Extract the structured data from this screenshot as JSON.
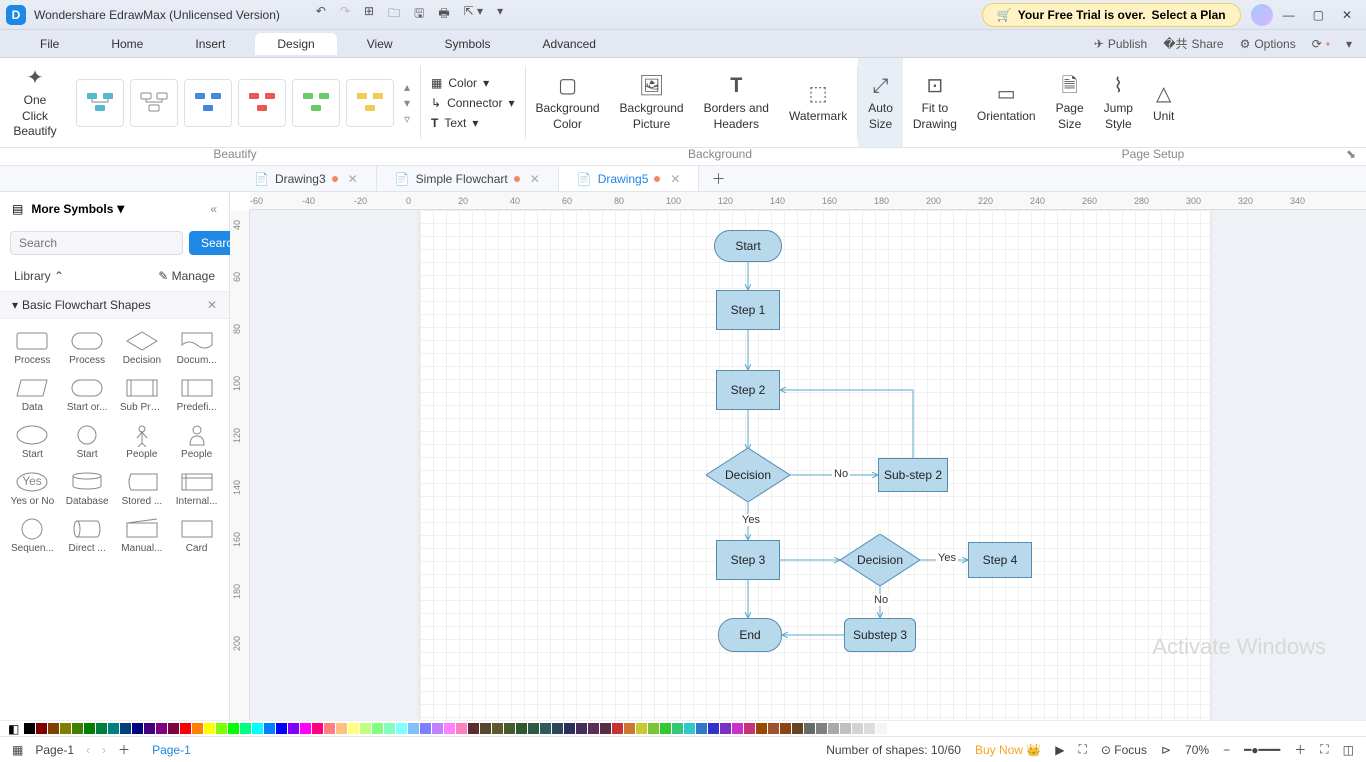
{
  "app": {
    "title": "Wondershare EdrawMax (Unlicensed Version)",
    "trial": "Your Free Trial is over.",
    "trial_cta": "Select a Plan"
  },
  "menu": {
    "items": [
      "File",
      "Home",
      "Insert",
      "Design",
      "View",
      "Symbols",
      "Advanced"
    ],
    "active": 3,
    "right": {
      "publish": "Publish",
      "share": "Share",
      "options": "Options"
    }
  },
  "ribbon": {
    "beautify": {
      "btn": "One Click\nBeautify",
      "label": "Beautify"
    },
    "midcol": {
      "color": "Color",
      "connector": "Connector",
      "text": "Text"
    },
    "bg": {
      "bgcolor": "Background\nColor",
      "bgpic": "Background\nPicture",
      "borders": "Borders and\nHeaders",
      "watermark": "Watermark",
      "label": "Background"
    },
    "ps": {
      "autosize": "Auto\nSize",
      "fit": "Fit to\nDrawing",
      "orient": "Orientation",
      "pagesize": "Page\nSize",
      "jump": "Jump\nStyle",
      "unit": "Unit",
      "label": "Page Setup"
    }
  },
  "tabs": [
    {
      "name": "Drawing3",
      "dirty": true
    },
    {
      "name": "Simple Flowchart",
      "dirty": true
    },
    {
      "name": "Drawing5",
      "dirty": true
    }
  ],
  "tabs_active": 2,
  "sidebar": {
    "more": "More Symbols",
    "search_ph": "Search",
    "search_btn": "Search",
    "library": "Library",
    "manage": "Manage",
    "panel": "Basic Flowchart Shapes",
    "shapes": [
      "Process",
      "Process",
      "Decision",
      "Docum...",
      "Data",
      "Start or...",
      "Sub Pro...",
      "Predefi...",
      "Start",
      "Start",
      "People",
      "People",
      "Yes or No",
      "Database",
      "Stored ...",
      "Internal...",
      "Sequen...",
      "Direct ...",
      "Manual...",
      "Card"
    ]
  },
  "flow": {
    "start": "Start",
    "step1": "Step 1",
    "step2": "Step 2",
    "decision1": "Decision",
    "substep2": "Sub-step 2",
    "step3": "Step 3",
    "decision2": "Decision",
    "step4": "Step 4",
    "substep3": "Substep 3",
    "end": "End",
    "yes": "Yes",
    "no": "No"
  },
  "ruler_h": [
    -60,
    -40,
    -20,
    0,
    20,
    40,
    60,
    80,
    100,
    120,
    140,
    160,
    180,
    200,
    220,
    240,
    260,
    280,
    300,
    320,
    340
  ],
  "ruler_v": [
    40,
    60,
    80,
    100,
    120,
    140,
    160,
    180,
    200
  ],
  "colors": [
    "#000000",
    "#7f0000",
    "#804000",
    "#808000",
    "#408000",
    "#008000",
    "#008040",
    "#008080",
    "#004080",
    "#000080",
    "#400080",
    "#800080",
    "#800040",
    "#ff0000",
    "#ff8000",
    "#ffff00",
    "#80ff00",
    "#00ff00",
    "#00ff80",
    "#00ffff",
    "#0080ff",
    "#0000ff",
    "#8000ff",
    "#ff00ff",
    "#ff0080",
    "#ff8080",
    "#ffc080",
    "#ffff80",
    "#c0ff80",
    "#80ff80",
    "#80ffc0",
    "#80ffff",
    "#80c0ff",
    "#8080ff",
    "#c080ff",
    "#ff80ff",
    "#ff80c0",
    "#5a2d2d",
    "#5a462d",
    "#5a5a2d",
    "#465a2d",
    "#2d5a2d",
    "#2d5a46",
    "#2d5a5a",
    "#2d465a",
    "#2d2d5a",
    "#462d5a",
    "#5a2d5a",
    "#5a2d46",
    "#c83232",
    "#c87832",
    "#c8c832",
    "#78c832",
    "#32c832",
    "#32c878",
    "#32c8c8",
    "#3278c8",
    "#3232c8",
    "#7832c8",
    "#c832c8",
    "#c83278",
    "#964b00",
    "#a0522d",
    "#8b4513",
    "#654321",
    "#696969",
    "#808080",
    "#a9a9a9",
    "#c0c0c0",
    "#d3d3d3",
    "#dcdcdc",
    "#f5f5f5",
    "#ffffff"
  ],
  "status": {
    "page": "Page-1",
    "pagelab": "Page-1",
    "shapes": "Number of shapes: 10/60",
    "buy": "Buy Now",
    "focus": "Focus",
    "zoom": "70%"
  },
  "watermark": "Activate Windows"
}
